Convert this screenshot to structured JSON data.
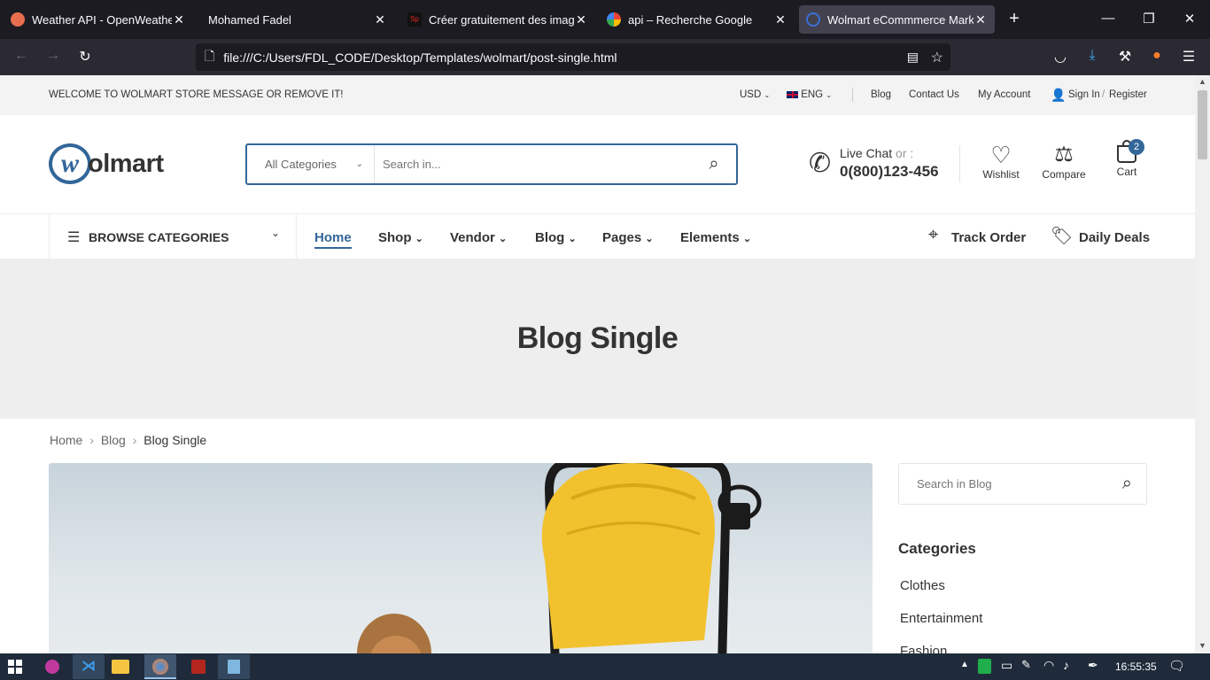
{
  "browser": {
    "tabs": [
      {
        "title": "Weather API - OpenWeatherMap",
        "active": false
      },
      {
        "title": "Mohamed Fadel",
        "active": false
      },
      {
        "title": "Créer gratuitement des images,",
        "active": false
      },
      {
        "title": "api – Recherche Google",
        "active": false
      },
      {
        "title": "Wolmart eCommmerce Marketpl",
        "active": true
      }
    ],
    "new_tab": "+",
    "url": "file:///C:/Users/FDL_CODE/Desktop/Templates/wolmart/post-single.html"
  },
  "topbar": {
    "welcome": "WELCOME TO WOLMART STORE MESSAGE OR REMOVE IT!",
    "currency": "USD",
    "language": "ENG",
    "blog": "Blog",
    "contact": "Contact Us",
    "account": "My Account",
    "signin": "Sign In",
    "sep": "/",
    "register": "Register"
  },
  "header": {
    "logo_mark": "w",
    "logo_text": "olmart",
    "category_select": "All Categories",
    "search_placeholder": "Search in...",
    "live_chat": "Live Chat",
    "or": "or :",
    "phone": "0(800)123-456",
    "wishlist": "Wishlist",
    "compare": "Compare",
    "cart": "Cart",
    "cart_count": "2"
  },
  "nav": {
    "browse": "BROWSE CATEGORIES",
    "items": [
      "Home",
      "Shop",
      "Vendor",
      "Blog",
      "Pages",
      "Elements"
    ],
    "track": "Track Order",
    "deals": "Daily Deals"
  },
  "banner": {
    "title": "Blog Single"
  },
  "breadcrumb": [
    "Home",
    "Blog",
    "Blog Single"
  ],
  "sidebar": {
    "search_placeholder": "Search in Blog",
    "categories_title": "Categories",
    "categories": [
      "Clothes",
      "Entertainment",
      "Fashion"
    ]
  },
  "taskbar": {
    "time": "16:55:35"
  },
  "colors": {
    "accent": "#336699",
    "browser_bg": "#1c1b22",
    "toolbar": "#2b2a33",
    "taskbar": "#1f2b3a",
    "cart_badge": "#336699"
  }
}
